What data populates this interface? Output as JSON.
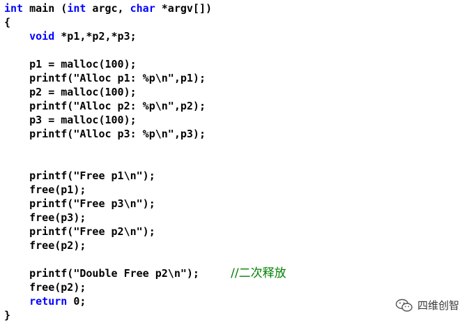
{
  "code": {
    "lines": [
      [
        {
          "t": "kw",
          "v": "int"
        },
        {
          "t": "plain",
          "v": " main ("
        },
        {
          "t": "kw",
          "v": "int"
        },
        {
          "t": "plain",
          "v": " argc, "
        },
        {
          "t": "kw",
          "v": "char"
        },
        {
          "t": "plain",
          "v": " *argv[])"
        }
      ],
      [
        {
          "t": "plain",
          "v": "{"
        }
      ],
      [
        {
          "t": "plain",
          "v": "    "
        },
        {
          "t": "kw",
          "v": "void"
        },
        {
          "t": "plain",
          "v": " *p1,*p2,*p3;"
        }
      ],
      [],
      [
        {
          "t": "plain",
          "v": "    p1 = malloc(100);"
        }
      ],
      [
        {
          "t": "plain",
          "v": "    printf(\"Alloc p1: %p\\n\",p1);"
        }
      ],
      [
        {
          "t": "plain",
          "v": "    p2 = malloc(100);"
        }
      ],
      [
        {
          "t": "plain",
          "v": "    printf(\"Alloc p2: %p\\n\",p2);"
        }
      ],
      [
        {
          "t": "plain",
          "v": "    p3 = malloc(100);"
        }
      ],
      [
        {
          "t": "plain",
          "v": "    printf(\"Alloc p3: %p\\n\",p3);"
        }
      ],
      [],
      [],
      [
        {
          "t": "plain",
          "v": "    printf(\"Free p1\\n\");"
        }
      ],
      [
        {
          "t": "plain",
          "v": "    free(p1);"
        }
      ],
      [
        {
          "t": "plain",
          "v": "    printf(\"Free p3\\n\");"
        }
      ],
      [
        {
          "t": "plain",
          "v": "    free(p3);"
        }
      ],
      [
        {
          "t": "plain",
          "v": "    printf(\"Free p2\\n\");"
        }
      ],
      [
        {
          "t": "plain",
          "v": "    free(p2);"
        }
      ],
      [],
      [
        {
          "t": "plain",
          "v": "    printf(\"Double Free p2\\n\");     "
        },
        {
          "t": "comment",
          "v": "//二次释放"
        }
      ],
      [
        {
          "t": "plain",
          "v": "    free(p2);"
        }
      ],
      [
        {
          "t": "plain",
          "v": "    "
        },
        {
          "t": "kw",
          "v": "return"
        },
        {
          "t": "plain",
          "v": " 0;"
        }
      ],
      [
        {
          "t": "plain",
          "v": "}"
        }
      ]
    ]
  },
  "watermark": {
    "text": "四维创智",
    "icon": "wechat-icon"
  },
  "colors": {
    "keyword": "#0000ff",
    "plain": "#000000",
    "comment": "#008000",
    "background": "#ffffff"
  }
}
